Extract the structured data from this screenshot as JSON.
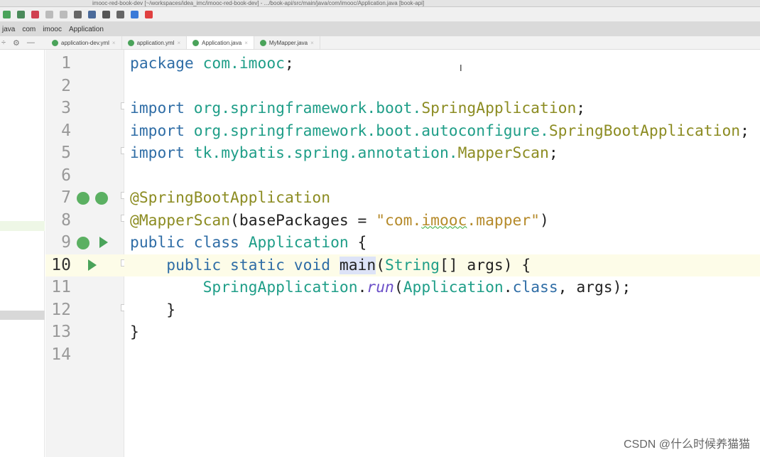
{
  "window": {
    "title": "imooc-red-book-dev [~/workspaces/idea_imc/imooc-red-book-dev] - .../book-api/src/main/java/com/imooc/Application.java [book-api]"
  },
  "toolbar": {
    "icons": [
      "debug-icon",
      "coverage-icon",
      "stop-icon",
      "build-icon",
      "run-config-icon",
      "wrench-icon",
      "project-structure-icon",
      "search-icon",
      "vcs-icon",
      "translate-icon",
      "plugin-icon"
    ]
  },
  "breadcrumbs": [
    "java",
    "com",
    "imooc",
    "Application"
  ],
  "tabs": [
    {
      "label": "application-dev.yml",
      "active": false
    },
    {
      "label": "application.yml",
      "active": false
    },
    {
      "label": "Application.java",
      "active": true
    },
    {
      "label": "MyMapper.java",
      "active": false
    }
  ],
  "editor": {
    "current_line": 10,
    "lines": [
      {
        "n": "1",
        "tokens": [
          [
            "package ",
            "kw"
          ],
          [
            "com.imooc",
            "pk"
          ],
          [
            ";",
            ""
          ]
        ]
      },
      {
        "n": "2",
        "tokens": []
      },
      {
        "n": "3",
        "tokens": [
          [
            "import ",
            "kw"
          ],
          [
            "org.springframework.boot.",
            "pk"
          ],
          [
            "SpringApplication",
            "oc"
          ],
          [
            ";",
            ""
          ]
        ]
      },
      {
        "n": "4",
        "tokens": [
          [
            "import ",
            "kw"
          ],
          [
            "org.springframework.boot.autoconfigure.",
            "pk"
          ],
          [
            "SpringBootApplication",
            "oc"
          ],
          [
            ";",
            ""
          ]
        ]
      },
      {
        "n": "5",
        "tokens": [
          [
            "import ",
            "kw"
          ],
          [
            "tk.mybatis.spring.annotation.",
            "pk"
          ],
          [
            "MapperScan",
            "oc"
          ],
          [
            ";",
            ""
          ]
        ]
      },
      {
        "n": "6",
        "tokens": []
      },
      {
        "n": "7",
        "tokens": [
          [
            "@SpringBootApplication",
            "an"
          ]
        ]
      },
      {
        "n": "8",
        "tokens": [
          [
            "@MapperScan",
            "an"
          ],
          [
            "(basePackages = ",
            ""
          ],
          [
            "\"com.",
            "st"
          ],
          [
            "imooc",
            "st squig"
          ],
          [
            ".mapper\"",
            "st"
          ],
          [
            ")",
            ""
          ]
        ]
      },
      {
        "n": "9",
        "tokens": [
          [
            "public class ",
            "kw"
          ],
          [
            "Application",
            "cl"
          ],
          [
            " {",
            ""
          ]
        ]
      },
      {
        "n": "10",
        "tokens": [
          [
            "    public static void ",
            "kw"
          ],
          [
            "main",
            "sel"
          ],
          [
            "(",
            ""
          ],
          [
            "String",
            "cl"
          ],
          [
            "[] args) {",
            ""
          ]
        ]
      },
      {
        "n": "11",
        "tokens": [
          [
            "        ",
            ""
          ],
          [
            "SpringApplication",
            "cl"
          ],
          [
            ".",
            ""
          ],
          [
            "run",
            "it"
          ],
          [
            "(",
            ""
          ],
          [
            "Application",
            "cl"
          ],
          [
            ".",
            ""
          ],
          [
            "class",
            "kw"
          ],
          [
            ", args);",
            ""
          ]
        ]
      },
      {
        "n": "12",
        "tokens": [
          [
            "    }",
            ""
          ]
        ]
      },
      {
        "n": "13",
        "tokens": [
          [
            "}",
            ""
          ]
        ]
      },
      {
        "n": "14",
        "tokens": []
      }
    ]
  },
  "watermark": "CSDN @什么时候养猫猫"
}
